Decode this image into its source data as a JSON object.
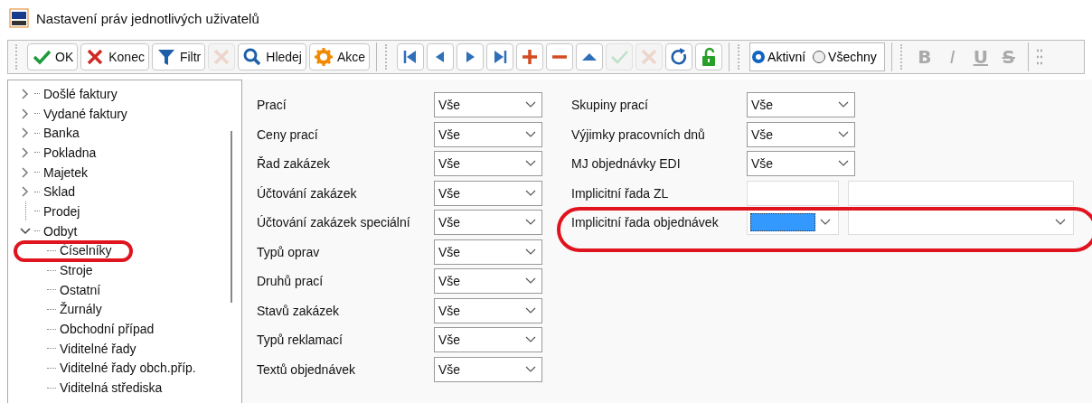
{
  "window": {
    "title": "Nastavení práv jednotlivých uživatelů"
  },
  "toolbar": {
    "buttons": [
      {
        "kind": "ok",
        "label": "OK",
        "disabled": false
      },
      {
        "kind": "close",
        "label": "Konec",
        "disabled": false
      },
      {
        "kind": "filter",
        "label": "Filtr",
        "disabled": false
      },
      {
        "kind": "clear",
        "disabled": true
      },
      {
        "kind": "search",
        "label": "Hledej",
        "disabled": false
      },
      {
        "kind": "actions",
        "label": "Akce",
        "disabled": false
      }
    ],
    "nav": [
      {
        "kind": "first",
        "disabled": false
      },
      {
        "kind": "prev",
        "disabled": false
      },
      {
        "kind": "next",
        "disabled": false
      },
      {
        "kind": "last",
        "disabled": false
      },
      {
        "kind": "add",
        "disabled": false
      },
      {
        "kind": "remove",
        "disabled": false
      },
      {
        "kind": "up",
        "disabled": false
      },
      {
        "kind": "confirm",
        "disabled": true
      },
      {
        "kind": "cancel",
        "disabled": true
      },
      {
        "kind": "refresh",
        "disabled": false
      },
      {
        "kind": "unlock",
        "disabled": false
      }
    ],
    "filter": [
      {
        "label": "Aktivní",
        "selected": true
      },
      {
        "label": "Všechny",
        "selected": false
      }
    ],
    "format": [
      {
        "kind": "bold",
        "label": "B"
      },
      {
        "kind": "italic",
        "label": "I"
      },
      {
        "kind": "underline",
        "label": "U"
      },
      {
        "kind": "strike",
        "label": "S"
      }
    ]
  },
  "tree": [
    {
      "label": "Došlé faktury",
      "expanded": false
    },
    {
      "label": "Vydané faktury",
      "expanded": false
    },
    {
      "label": "Banka",
      "expanded": false
    },
    {
      "label": "Pokladna",
      "expanded": false
    },
    {
      "label": "Majetek",
      "expanded": false
    },
    {
      "label": "Sklad",
      "expanded": false
    },
    {
      "label": "Prodej"
    },
    {
      "label": "Odbyt",
      "expanded": true,
      "children": [
        {
          "label": "Číselníky",
          "highlighted": true
        },
        {
          "label": "Stroje",
          "highlighted": false
        },
        {
          "label": "Ostatní",
          "highlighted": false
        },
        {
          "label": "Žurnály",
          "highlighted": false
        },
        {
          "label": "Obchodní případ",
          "highlighted": false
        },
        {
          "label": "Viditelné řady",
          "highlighted": false
        },
        {
          "label": "Viditelné řady obch.příp.",
          "highlighted": false
        },
        {
          "label": "Viditelná střediska",
          "highlighted": false
        }
      ]
    }
  ],
  "form": {
    "left": [
      {
        "label": "Prací",
        "value": "Vše"
      },
      {
        "label": "Ceny prací",
        "value": "Vše"
      },
      {
        "label": "Řad zakázek",
        "value": "Vše"
      },
      {
        "label": "Účtování zakázek",
        "value": "Vše"
      },
      {
        "label": "Účtování zakázek speciální",
        "value": "Vše"
      },
      {
        "label": "Typů oprav",
        "value": "Vše"
      },
      {
        "label": "Druhů prací",
        "value": "Vše"
      },
      {
        "label": "Stavů zakázek",
        "value": "Vše"
      },
      {
        "label": "Typů reklamací",
        "value": "Vše"
      },
      {
        "label": "Textů objednávek",
        "value": "Vše"
      }
    ],
    "right": [
      {
        "kind": "select",
        "label": "Skupiny prací",
        "value": "Vše",
        "highlighted": false
      },
      {
        "kind": "select",
        "label": "Výjimky pracovních dnů",
        "value": "Vše",
        "highlighted": false
      },
      {
        "kind": "select",
        "label": "MJ objednávky EDI",
        "value": "Vše",
        "highlighted": false
      },
      {
        "kind": "pair",
        "label": "Implicitní řada ZL",
        "highlighted": false
      },
      {
        "kind": "pair-combo",
        "label": "Implicitní řada objednávek",
        "focused": true,
        "highlighted": true
      }
    ]
  }
}
